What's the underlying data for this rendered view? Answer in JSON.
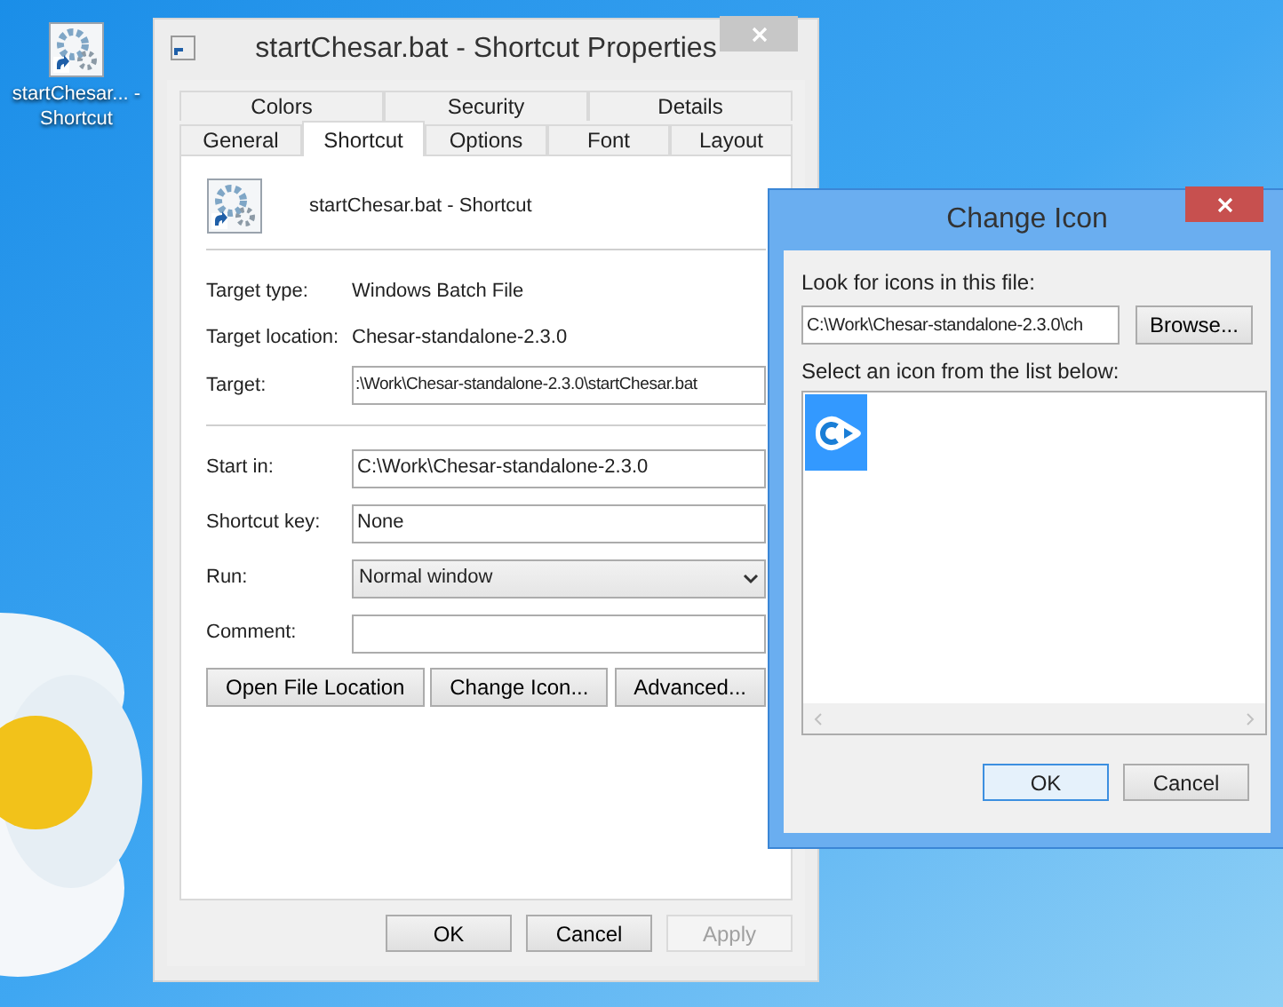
{
  "desktop_icon": {
    "label": "startChesar... - Shortcut"
  },
  "properties_window": {
    "title": "startChesar.bat - Shortcut Properties",
    "active": false,
    "tab_rows": [
      [
        {
          "label": "Colors",
          "selected": false
        },
        {
          "label": "Security",
          "selected": false
        },
        {
          "label": "Details",
          "selected": false
        }
      ],
      [
        {
          "label": "General",
          "selected": false
        },
        {
          "label": "Shortcut",
          "selected": true
        },
        {
          "label": "Options",
          "selected": false
        },
        {
          "label": "Font",
          "selected": false
        },
        {
          "label": "Layout",
          "selected": false
        }
      ]
    ],
    "header": "startChesar.bat - Shortcut",
    "details": [
      {
        "label": "Target type:",
        "value": "Windows Batch File"
      },
      {
        "label": "Target location:",
        "value": "Chesar-standalone-2.3.0"
      }
    ],
    "target": {
      "label": "Target:",
      "value": ":\\Work\\Chesar-standalone-2.3.0\\startChesar.bat"
    },
    "fields": [
      {
        "kind": "input",
        "label": "Start in:",
        "value": "C:\\Work\\Chesar-standalone-2.3.0"
      },
      {
        "kind": "input",
        "label": "Shortcut key:",
        "value": "None"
      },
      {
        "kind": "select",
        "label": "Run:",
        "value": "Normal window"
      },
      {
        "kind": "input",
        "label": "Comment:"
      }
    ],
    "actions": [
      "Open File Location",
      "Change Icon...",
      "Advanced..."
    ],
    "footer_buttons": [
      {
        "label": "OK",
        "disabled": false
      },
      {
        "label": "Cancel",
        "disabled": false
      },
      {
        "label": "Apply",
        "disabled": true
      }
    ]
  },
  "change_icon_window": {
    "title": "Change Icon",
    "active": true,
    "file_label": "Look for icons in this file:",
    "file_path": "C:\\Work\\Chesar-standalone-2.3.0\\ch",
    "browse": "Browse...",
    "list_label": "Select an icon from the list below:",
    "icons": [
      {
        "selected": true
      }
    ],
    "buttons": [
      {
        "label": "OK",
        "default": true
      },
      {
        "label": "Cancel",
        "default": false
      }
    ]
  }
}
